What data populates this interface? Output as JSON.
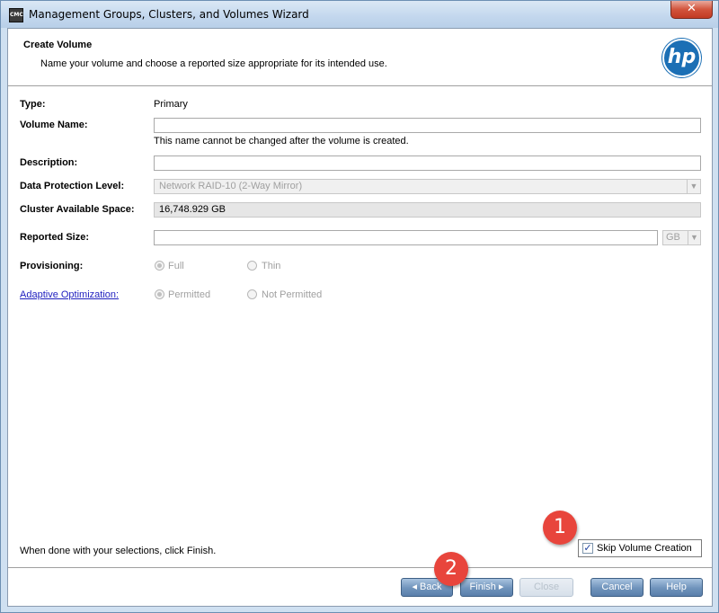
{
  "window": {
    "title": "Management Groups, Clusters, and Volumes Wizard",
    "app_icon_text": "CMC",
    "close_glyph": "✕"
  },
  "header": {
    "title": "Create Volume",
    "subtitle": "Name your volume and choose a reported size appropriate for its intended use.",
    "logo_text": "hp"
  },
  "form": {
    "type_label": "Type:",
    "type_value": "Primary",
    "volume_name_label": "Volume Name:",
    "volume_name_value": "",
    "volume_name_note": "This name cannot be changed after the volume is created.",
    "description_label": "Description:",
    "description_value": "",
    "protection_label": "Data Protection Level:",
    "protection_value": "Network RAID-10 (2-Way Mirror)",
    "cluster_space_label": "Cluster Available Space:",
    "cluster_space_value": "16,748.929 GB",
    "reported_size_label": "Reported Size:",
    "reported_size_value": "",
    "reported_size_unit": "GB",
    "provisioning_label": "Provisioning:",
    "provisioning_options": [
      "Full",
      "Thin"
    ],
    "provisioning_selected": "Full",
    "adaptive_label": "Adaptive Optimization:",
    "adaptive_options": [
      "Permitted",
      "Not Permitted"
    ],
    "adaptive_selected": "Permitted"
  },
  "footer": {
    "instruction": "When done with your selections, click Finish.",
    "skip_label": "Skip Volume Creation",
    "skip_checked": true
  },
  "buttons": {
    "back": "Back",
    "finish": "Finish",
    "close": "Close",
    "cancel": "Cancel",
    "help": "Help"
  },
  "annotations": {
    "badge_1": "1",
    "badge_2": "2"
  },
  "colors": {
    "link": "#1f1fbf",
    "badge": "#e8453c",
    "hp_blue": "#1b6fb5"
  }
}
